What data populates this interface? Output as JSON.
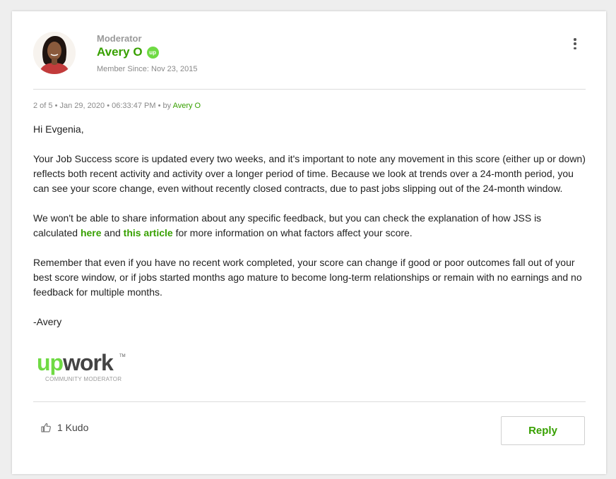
{
  "author": {
    "role": "Moderator",
    "name": "Avery O",
    "badge": "up",
    "member_since": "Member Since: Nov 23, 2015"
  },
  "meta": {
    "position": "2 of 5",
    "date": "Jan 29, 2020",
    "time": "06:33:47 PM",
    "by_label": "by",
    "author_link": "Avery O"
  },
  "body": {
    "greeting": "Hi Evgenia,",
    "p1": "Your Job Success score is updated every two weeks, and it's important to note any movement in this score (either up or down) reflects both recent activity and activity over a longer period of time. Because we look at trends over a 24-month period, you can see your score change, even without recently closed contracts, due to past jobs slipping out of the 24-month window.",
    "p2_before": "We won't be able to share information about any specific feedback, but you can check the explanation of how JSS is calculated ",
    "link_here": "here",
    "p2_mid": " and ",
    "link_article": "this article",
    "p2_after": " for more information on what factors affect your score.",
    "p3": "Remember that even if you have no recent work completed, your score can change if good or poor outcomes fall out of your best score window, or if jobs started months ago mature to become long-term relationships or remain with no earnings and no feedback for multiple months.",
    "signoff": "-Avery"
  },
  "logo": {
    "word_up": "up",
    "word_work": "work",
    "tm": "TM",
    "subtitle": "COMMUNITY MODERATOR"
  },
  "footer": {
    "kudo_label": "1 Kudo",
    "reply_label": "Reply"
  },
  "colors": {
    "brand_green": "#37a000",
    "logo_green": "#6fda44"
  }
}
